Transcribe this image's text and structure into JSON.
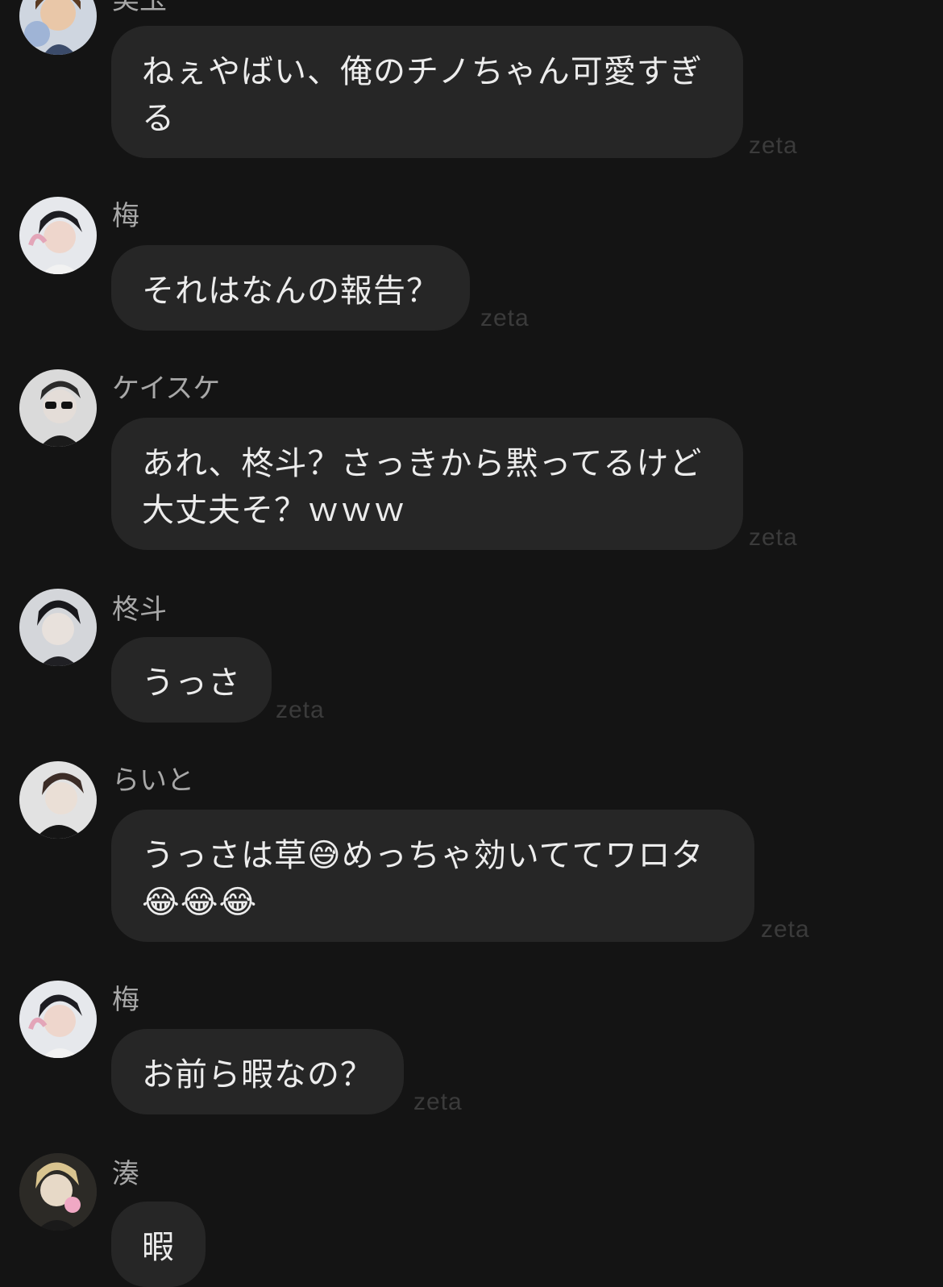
{
  "watermark": "zeta",
  "messages": [
    {
      "name": "美玉",
      "text": "ねぇやばい、俺のチノちゃん可愛すぎる"
    },
    {
      "name": "梅",
      "text": "それはなんの報告？"
    },
    {
      "name": "ケイスケ",
      "text": "あれ、柊斗？さっきから黙ってるけど大丈夫そ？ｗｗｗ"
    },
    {
      "name": "柊斗",
      "text": "うっさ"
    },
    {
      "name": "らいと",
      "text": "うっさは草😅めっちゃ効いててワロタ😂😂😂"
    },
    {
      "name": "梅",
      "text": "お前ら暇なの？"
    },
    {
      "name": "湊",
      "text": "暇"
    }
  ],
  "colors": {
    "background": "#141414",
    "bubble": "#262626",
    "name": "#a8a8a8",
    "text": "#ececec",
    "watermark": "#3b3b3b"
  },
  "icons": [
    "avatar-miyu",
    "avatar-ume",
    "avatar-keisuke",
    "avatar-shuto",
    "avatar-raito",
    "avatar-minato"
  ]
}
